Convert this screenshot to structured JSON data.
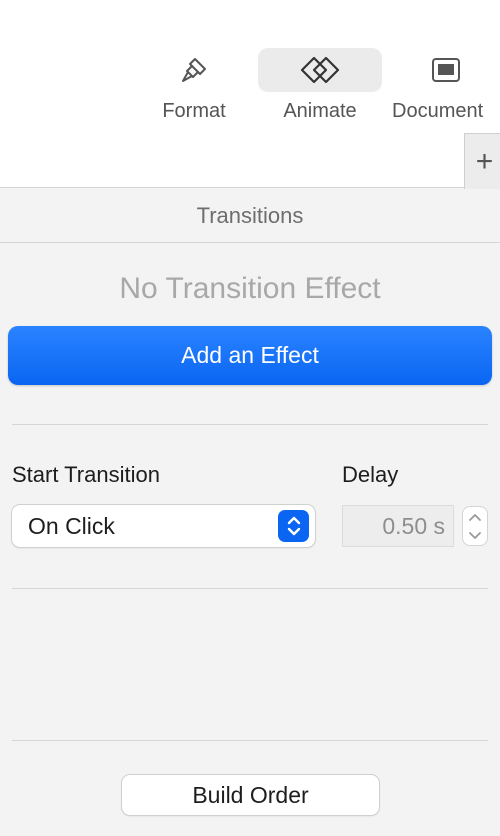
{
  "toolbar": {
    "tabs": [
      {
        "label": "Format",
        "icon": "paintbrush-icon",
        "selected": false
      },
      {
        "label": "Animate",
        "icon": "animate-diamond-icon",
        "selected": true
      },
      {
        "label": "Document",
        "icon": "document-icon",
        "selected": false
      }
    ],
    "add_symbol": "+"
  },
  "panel": {
    "section_title": "Transitions",
    "empty_state": "No Transition Effect",
    "add_effect_label": "Add an Effect",
    "start_transition_label": "Start Transition",
    "start_transition_value": "On Click",
    "delay_label": "Delay",
    "delay_value": "0.50 s",
    "build_order_label": "Build Order"
  },
  "colors": {
    "accent": "#0a66f2",
    "panel_bg": "#f3f3f3",
    "toolbar_bg": "#ffffff"
  }
}
